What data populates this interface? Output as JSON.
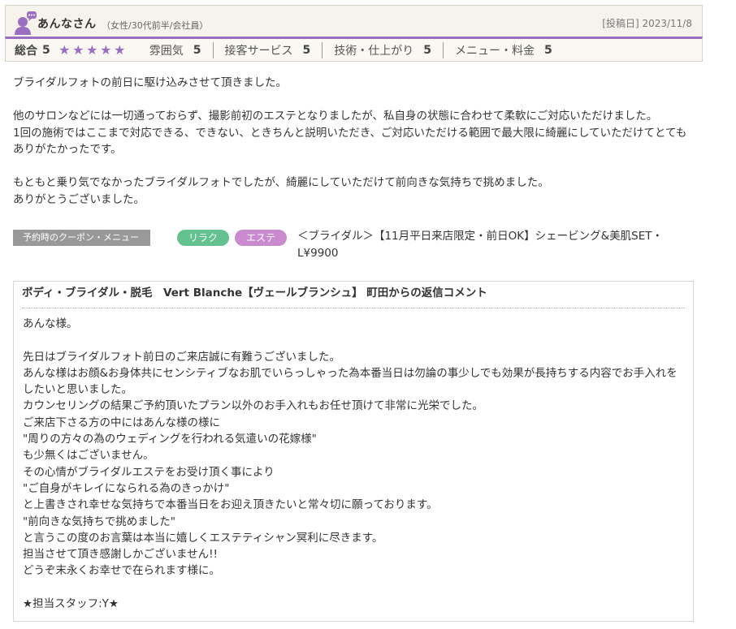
{
  "reviewer": {
    "name": "あんなさん",
    "profile": "（女性/30代前半/会社員）",
    "post_date": "[投稿日] 2023/11/8"
  },
  "ratings": {
    "overall_label": "総合",
    "overall_score": "5",
    "stars": 5,
    "star_color": "#9a6fc2",
    "items": [
      {
        "label": "雰囲気",
        "value": "5"
      },
      {
        "label": "接客サービス",
        "value": "5"
      },
      {
        "label": "技術・仕上がり",
        "value": "5"
      },
      {
        "label": "メニュー・料金",
        "value": "5"
      }
    ]
  },
  "review": {
    "paragraphs": [
      "ブライダルフォトの前日に駆け込みさせて頂きました。",
      "他のサロンなどには一切通っておらず、撮影前初のエステとなりましたが、私自身の状態に合わせて柔軟にご対応いただけました。\n1回の施術ではここまで対応できる、できない、ときちんと説明いただき、ご対応いただける範囲で最大限に綺麗にしていただけてとても\nありがたかったです。",
      "もともと乗り気でなかったブライダルフォトでしたが、綺麗にしていただけて前向きな気持ちで挑めました。\nありがとうございました。"
    ]
  },
  "coupon": {
    "label": "予約時のクーポン・メニュー",
    "tags": [
      {
        "text": "リラク",
        "color": "#63c28f"
      },
      {
        "text": "エステ",
        "color": "#c98ad0"
      }
    ],
    "text": "＜ブライダル＞【11月平日来店限定・前日OK】シェービング&美肌SET・\nL¥9900"
  },
  "reply": {
    "title": "ボディ・ブライダル・脱毛　Vert Blanche【ヴェールブランシュ】 町田からの返信コメント",
    "paragraphs": [
      "あんな様。",
      "先日はブライダルフォト前日のご来店誠に有難うございました。\nあんな様はお顔&お身体共にセンシティブなお肌でいらっしゃった為本番当日は勿論の事少しでも効果が長持ちする内容でお手入れを\nしたいと思いました。\nカウンセリングの結果ご予約頂いたプラン以外のお手入れもお任せ頂けて非常に光栄でした。\nご来店下さる方の中にはあんな様の様に\n\"周りの方々の為のウェディングを行われる気遣いの花嫁様\"\nも少無くはございません。\nその心情がブライダルエステをお受け頂く事により\n\"ご自身がキレイになられる為のきっかけ\"\nと上書きされ幸せな気持ちで本番当日をお迎え頂きたいと常々切に願っております。\n\"前向きな気持ちで挑めました\"\nと言うこの度のお言葉は本当に嬉しくエステティシャン冥利に尽きます。\n担当させて頂き感謝しかございません!!\nどうぞ末永くお幸せで在られます様に。",
      "★担当スタッフ:Y★"
    ]
  }
}
